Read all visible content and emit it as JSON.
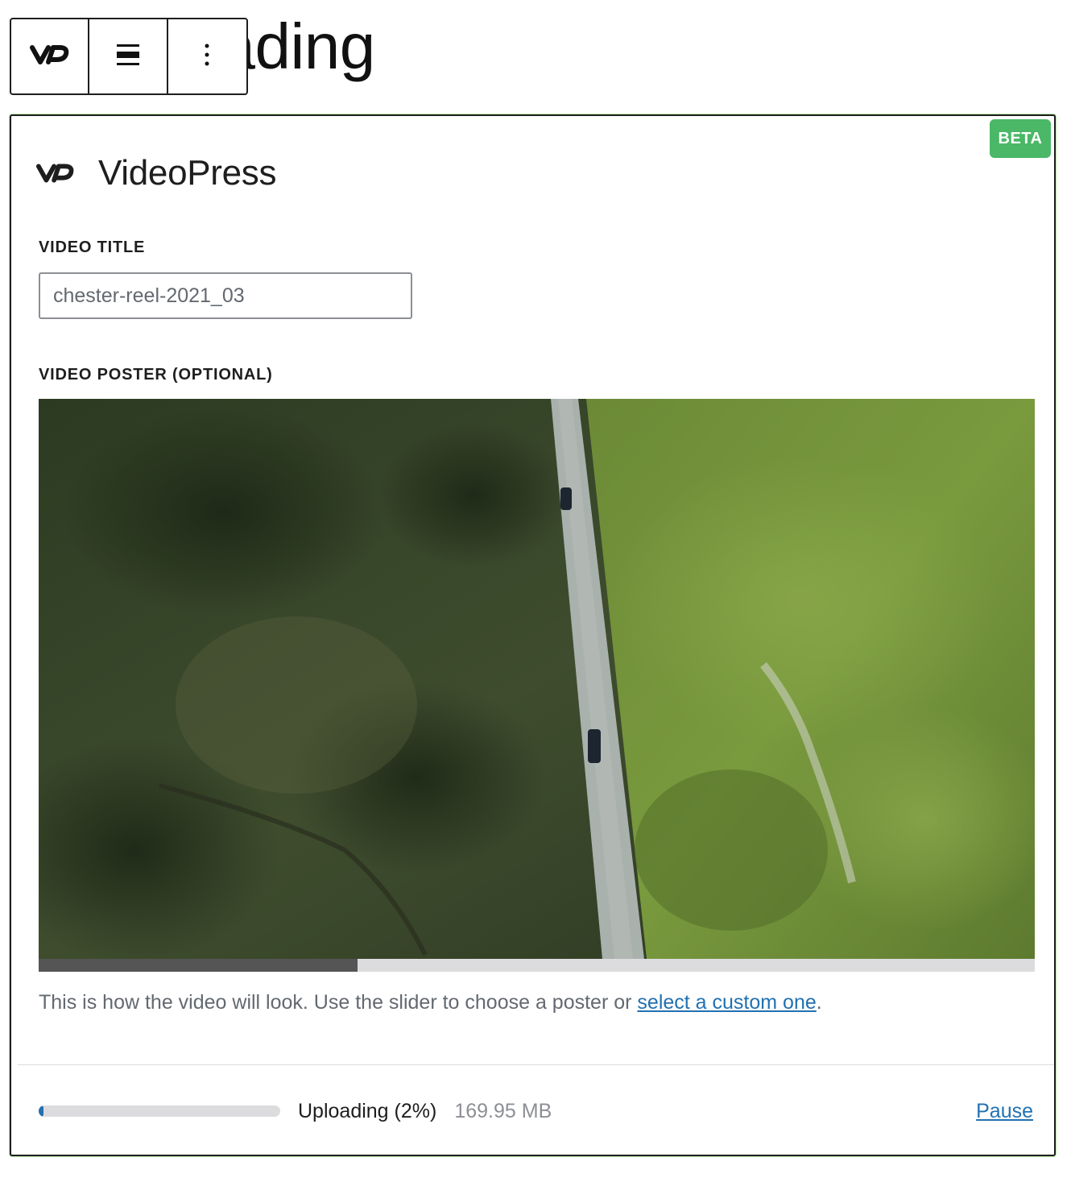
{
  "heading": {
    "text": "by uploading"
  },
  "toolbar": {
    "buttons": [
      {
        "icon": "videopress-logo-icon"
      },
      {
        "icon": "align-icon"
      },
      {
        "icon": "more-options-icon"
      }
    ]
  },
  "card": {
    "badge": "BETA",
    "brand": "VideoPress",
    "title_label": "VIDEO TITLE",
    "title_value": "chester-reel-2021_03",
    "poster_label": "VIDEO POSTER (OPTIONAL)",
    "poster_slider_position": 0.32,
    "help_text": "This is how the video will look. Use the slider to choose a poster or ",
    "help_link": "select a custom one",
    "help_period": "."
  },
  "upload": {
    "progress": 0.02,
    "status": "Uploading (2%)",
    "size": "169.95 MB",
    "pause_label": "Pause"
  },
  "colors": {
    "beta_badge": "#4ab866",
    "link": "#2271b1",
    "progress_fill": "#2271b1",
    "slider_fill": "#555555"
  }
}
